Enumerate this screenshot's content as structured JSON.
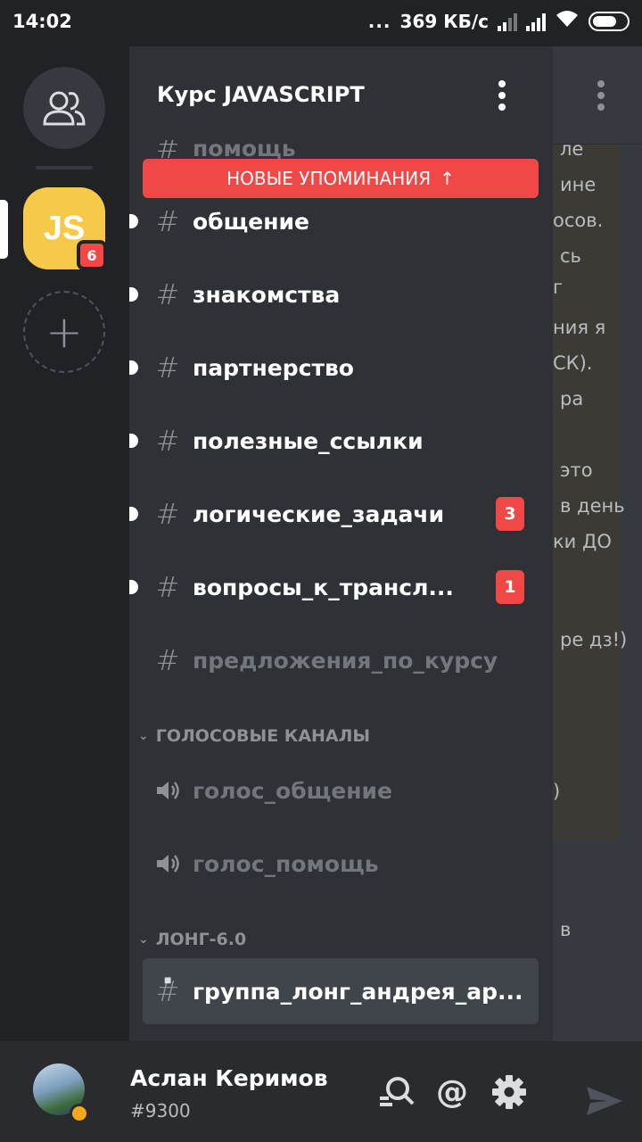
{
  "status_bar": {
    "time": "14:02",
    "dots": "...",
    "speed": "369 КБ/с"
  },
  "server": {
    "name": "Курс JAVASCRIPT",
    "icon_label": "JS",
    "badge": "6"
  },
  "mentions_banner": {
    "label": "НОВЫЕ УПОМИНАНИЯ",
    "arrow": "↑"
  },
  "channels": {
    "partial_top": "помощь",
    "list": [
      {
        "name": "общение",
        "count": ""
      },
      {
        "name": "знакомства",
        "count": ""
      },
      {
        "name": "партнерство",
        "count": ""
      },
      {
        "name": "полезные_ссылки",
        "count": ""
      },
      {
        "name": "логические_задачи",
        "count": "3"
      },
      {
        "name": "вопросы_к_трансл...",
        "count": "1"
      },
      {
        "name": "предложения_по_курсу",
        "count": ""
      }
    ]
  },
  "voice_category": {
    "title": "ГОЛОСОВЫЕ КАНАЛЫ",
    "channels": [
      "голос_общение",
      "голос_помощь"
    ]
  },
  "long_category": {
    "title": "ЛОНГ-6.0",
    "channels": [
      "группа_лонг_андрея_ар..."
    ]
  },
  "chat_fragments": [
    "ле",
    "ине",
    "осов.",
    "сь",
    "г",
    "ния я",
    "СК).",
    "ра",
    "это",
    "в день",
    "ки ДО",
    "ре дз!)",
    ")",
    "в"
  ],
  "user": {
    "name": "Аслан Керимов",
    "tag": "#9300",
    "at_symbol": "@"
  },
  "colors": {
    "accent_red": "#f04747",
    "server_yellow": "#f7c948",
    "status_idle": "#faa61a"
  }
}
